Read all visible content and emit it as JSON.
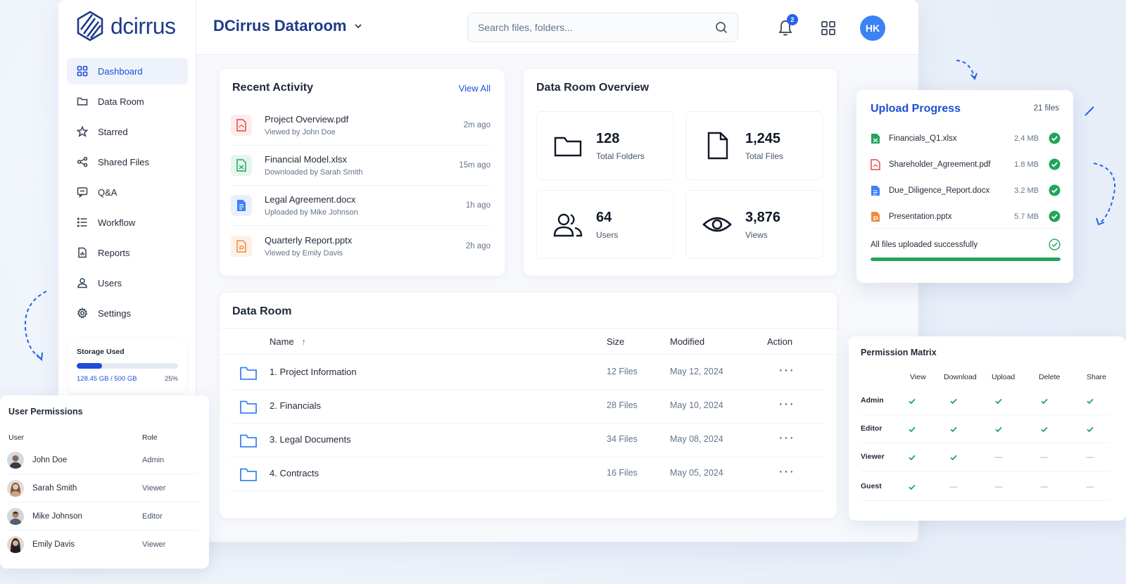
{
  "brand": {
    "name": "dcirrus"
  },
  "header": {
    "title": "DCirrus Dataroom",
    "search_placeholder": "Search files, folders...",
    "notifications_count": "2",
    "avatar_initials": "HK",
    "accent": "#1d4ed8"
  },
  "sidebar": {
    "items": [
      {
        "label": "Dashboard",
        "icon": "grid-icon",
        "active": true
      },
      {
        "label": "Data Room",
        "icon": "folder-icon"
      },
      {
        "label": "Starred",
        "icon": "star-icon"
      },
      {
        "label": "Shared Files",
        "icon": "share-icon"
      },
      {
        "label": "Q&A",
        "icon": "chat-icon"
      },
      {
        "label": "Workflow",
        "icon": "list-icon"
      },
      {
        "label": "Reports",
        "icon": "report-icon"
      },
      {
        "label": "Users",
        "icon": "user-icon"
      },
      {
        "label": "Settings",
        "icon": "gear-icon"
      }
    ],
    "storage": {
      "title": "Storage Used",
      "used": "128.45 GB / 500 GB",
      "percent_label": "25%",
      "fraction": 0.25
    }
  },
  "recent_activity": {
    "title": "Recent Activity",
    "view_all": "View All",
    "items": [
      {
        "name": "Project Overview.pdf",
        "sub": "Viewed by John Doe",
        "time": "2m ago",
        "type": "pdf"
      },
      {
        "name": "Financial Model.xlsx",
        "sub": "Downloaded by Sarah Smith",
        "time": "15m ago",
        "type": "xlsx"
      },
      {
        "name": "Legal Agreement.docx",
        "sub": "Uploaded by Mike Johnson",
        "time": "1h ago",
        "type": "docx"
      },
      {
        "name": "Quarterly Report.pptx",
        "sub": "Viewed by Emily Davis",
        "time": "2h ago",
        "type": "pptx"
      }
    ]
  },
  "overview": {
    "title": "Data Room Overview",
    "stats": [
      {
        "value": "128",
        "label": "Total Folders",
        "icon": "folder-icon"
      },
      {
        "value": "1,245",
        "label": "Total Files",
        "icon": "file-icon"
      },
      {
        "value": "64",
        "label": "Users",
        "icon": "users-icon"
      },
      {
        "value": "3,876",
        "label": "Views",
        "icon": "eye-icon"
      }
    ]
  },
  "data_room": {
    "title": "Data Room",
    "columns": {
      "name": "Name",
      "size": "Size",
      "modified": "Modified",
      "action": "Action"
    },
    "rows": [
      {
        "name": "1. Project Information",
        "size": "12 Files",
        "modified": "May 12, 2024"
      },
      {
        "name": "2. Financials",
        "size": "28 Files",
        "modified": "May 10, 2024"
      },
      {
        "name": "3. Legal Documents",
        "size": "34 Files",
        "modified": "May 08, 2024"
      },
      {
        "name": "4. Contracts",
        "size": "16 Files",
        "modified": "May 05, 2024"
      }
    ]
  },
  "upload": {
    "title": "Upload Progress",
    "count": "21 files",
    "files": [
      {
        "name": "Financials_Q1.xlsx",
        "size": "2.4 MB",
        "type": "xlsx"
      },
      {
        "name": "Shareholder_Agreement.pdf",
        "size": "1.8 MB",
        "type": "pdf"
      },
      {
        "name": "Due_Diligence_Report.docx",
        "size": "3.2 MB",
        "type": "docx"
      },
      {
        "name": "Presentation.pptx",
        "size": "5.7 MB",
        "type": "pptx"
      }
    ],
    "status": "All files uploaded successfully",
    "progress": 1.0
  },
  "permission_matrix": {
    "title": "Permission Matrix",
    "columns": [
      "View",
      "Download",
      "Upload",
      "Delete",
      "Share"
    ],
    "rows": [
      {
        "role": "Admin",
        "perms": [
          true,
          true,
          true,
          true,
          true
        ]
      },
      {
        "role": "Editor",
        "perms": [
          true,
          true,
          true,
          true,
          true
        ]
      },
      {
        "role": "Viewer",
        "perms": [
          true,
          true,
          false,
          false,
          false
        ]
      },
      {
        "role": "Guest",
        "perms": [
          true,
          false,
          false,
          false,
          false
        ]
      }
    ]
  },
  "user_permissions": {
    "title": "User Permissions",
    "columns": {
      "user": "User",
      "role": "Role"
    },
    "rows": [
      {
        "name": "John Doe",
        "role": "Admin"
      },
      {
        "name": "Sarah Smith",
        "role": "Viewer"
      },
      {
        "name": "Mike Johnson",
        "role": "Editor"
      },
      {
        "name": "Emily Davis",
        "role": "Viewer"
      }
    ]
  }
}
